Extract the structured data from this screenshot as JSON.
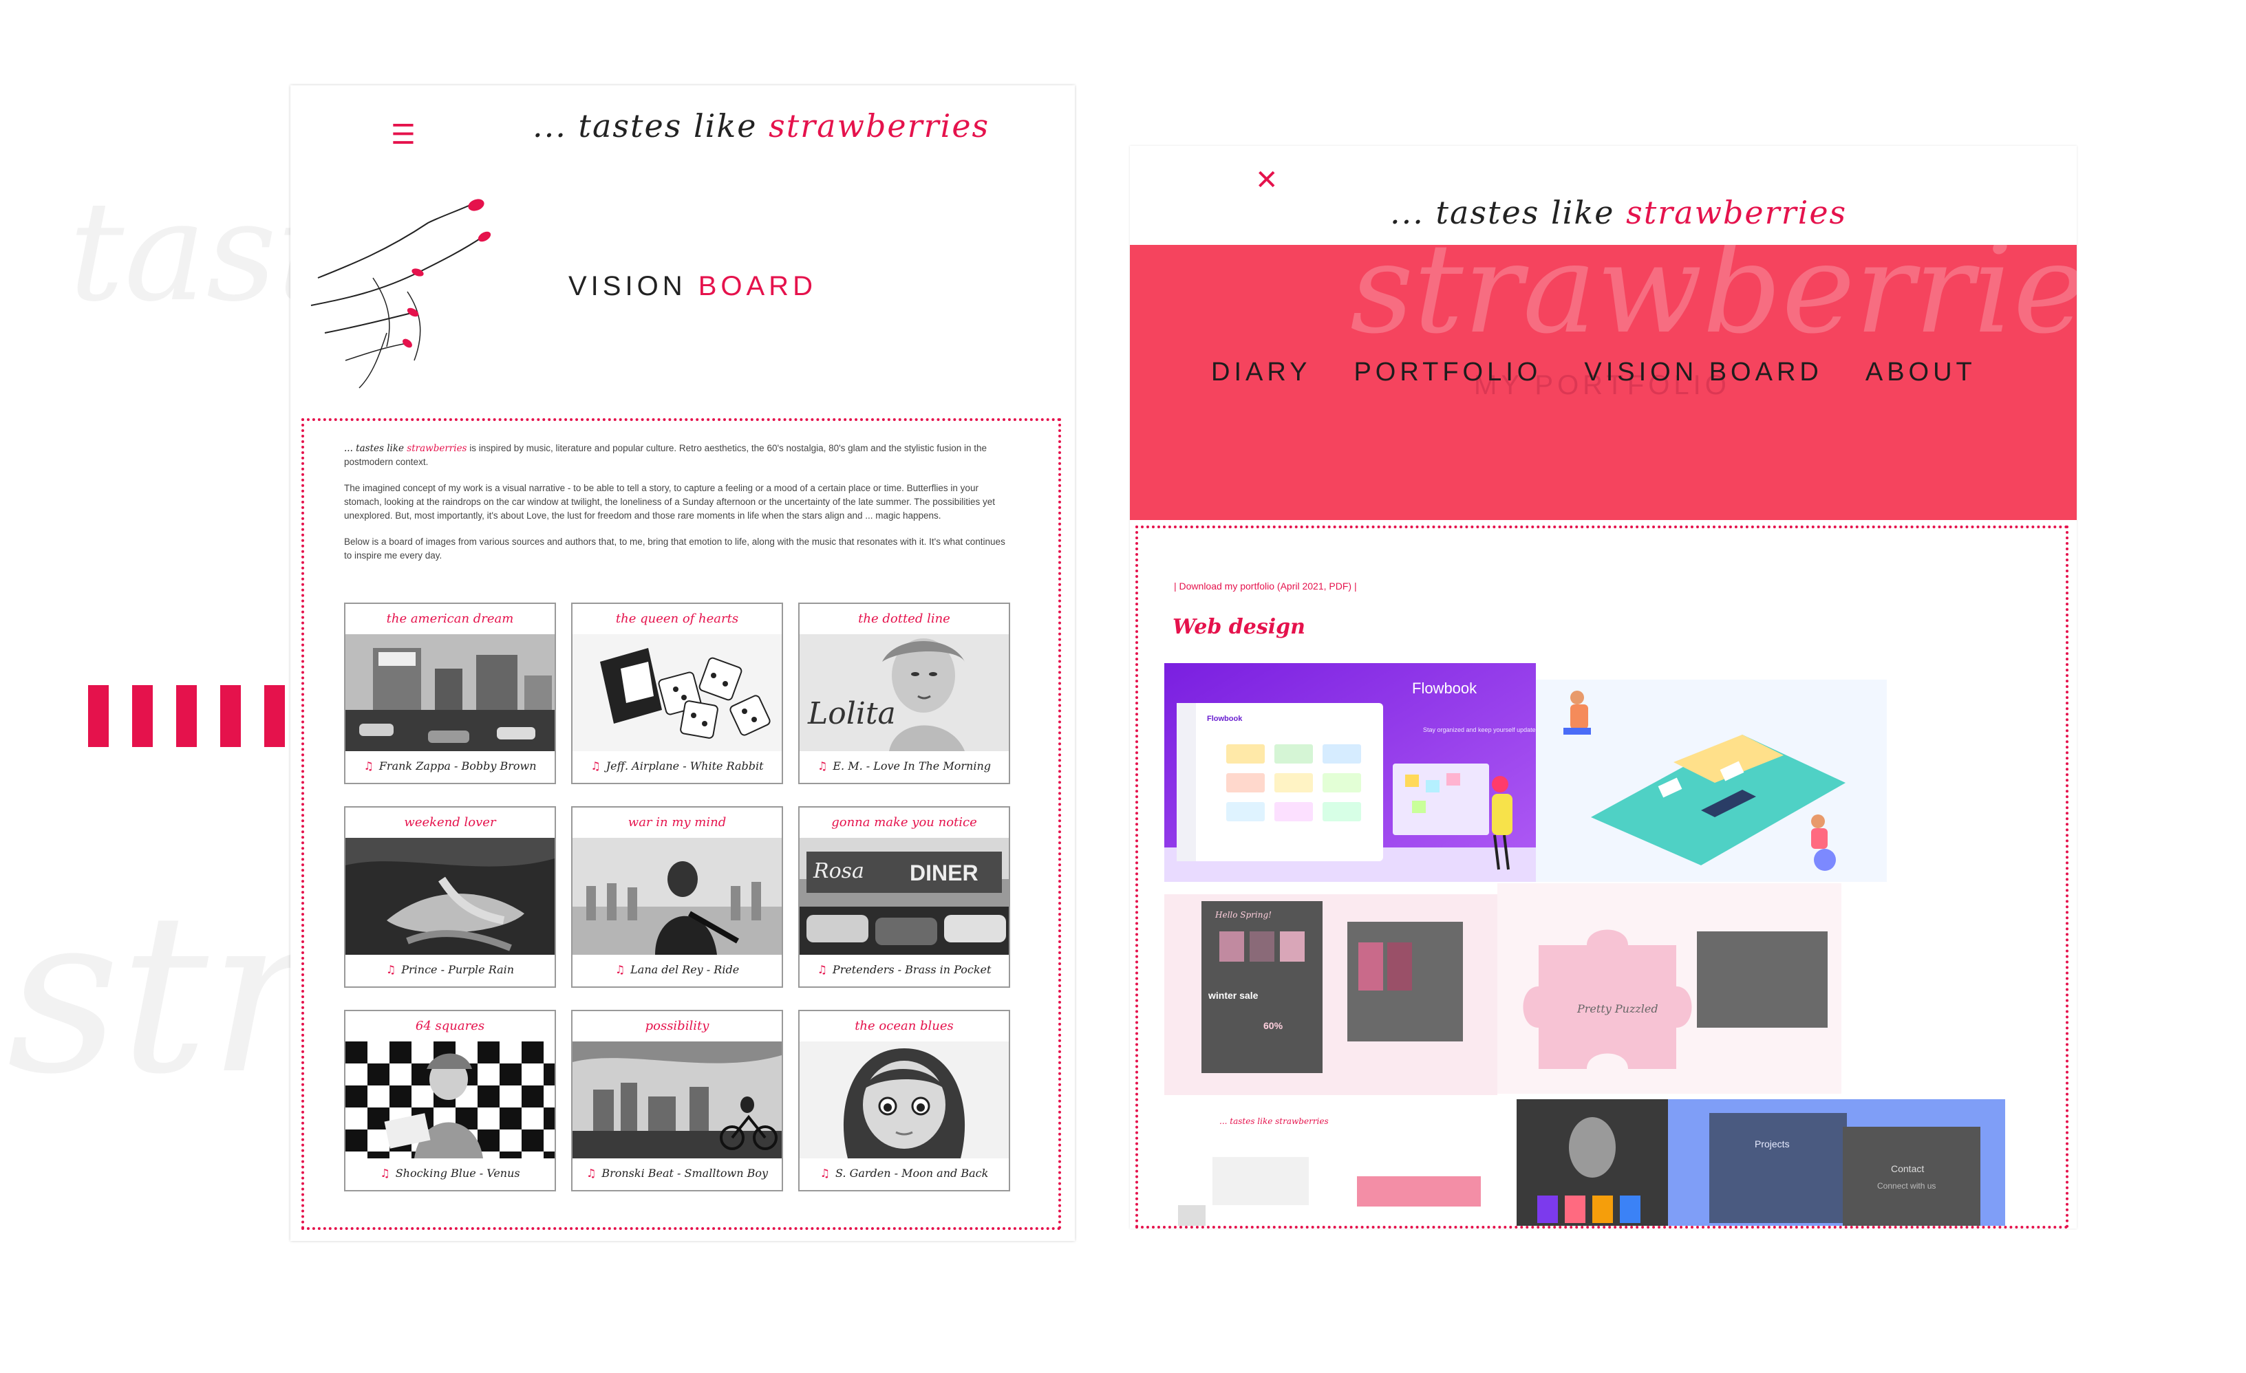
{
  "background": {
    "words": [
      "tastes",
      "str"
    ],
    "accent": "#e5124c"
  },
  "left": {
    "brand": {
      "prefix": "... tastes like ",
      "accent": "strawberries"
    },
    "menu_icon": "hamburger-icon",
    "title": {
      "first": "VISION ",
      "second": "BOARD"
    },
    "intro": {
      "lead_prefix": "... tastes like ",
      "lead_accent": "strawberries",
      "lead_rest": " is inspired by music, literature and popular culture. Retro aesthetics, the 60's nostalgia, 80's glam and the stylistic fusion in the postmodern context.",
      "p2": "The imagined concept of my work is a visual narrative - to be able to tell a story, to capture a feeling or a mood of a certain place or time. Butterflies in your stomach, looking at the raindrops on the car window at twilight, the loneliness of a Sunday afternoon or the uncertainty of the late summer. The possibilities yet unexplored. But, most importantly, it's about Love, the lust for freedom and those rare moments in life when the stars align and ... magic happens.",
      "p3": "Below is a board of images from various sources and authors that, to me, bring that emotion to life, along with the music that resonates with it. It's what continues to inspire me every day."
    },
    "cards": [
      {
        "title": "the american dream",
        "song": "Frank Zappa - Bobby Brown"
      },
      {
        "title": "the queen of hearts",
        "song": "Jeff. Airplane - White Rabbit"
      },
      {
        "title": "the dotted line",
        "song": "E. M. - Love In The Morning",
        "image_text": "Lolita"
      },
      {
        "title": "weekend lover",
        "song": "Prince - Purple Rain"
      },
      {
        "title": "war in my mind",
        "song": "Lana del Rey - Ride"
      },
      {
        "title": "gonna make you notice",
        "song": "Pretenders - Brass in Pocket",
        "image_text": "DINER"
      },
      {
        "title": "64 squares",
        "song": "Shocking Blue - Venus"
      },
      {
        "title": "possibility",
        "song": "Bronski Beat - Smalltown Boy"
      },
      {
        "title": "the ocean blues",
        "song": "S. Garden - Moon and Back"
      }
    ]
  },
  "right": {
    "close_icon": "close-icon",
    "brand": {
      "prefix": "... tastes like ",
      "accent": "strawberries"
    },
    "nav_bg": "#f5445e",
    "ghost_word": "strawberries",
    "ghost_sub": "MY PORTFOLIO",
    "nav": [
      "DIARY",
      "PORTFOLIO",
      "VISION BOARD",
      "ABOUT"
    ],
    "download": "| Download my portfolio (April 2021, PDF) |",
    "section_title": "Web design",
    "thumbs": {
      "flowbook_title": "Flowbook",
      "flowbook_tagline": "Stay organized and keep yourself updated.",
      "pretty_puzzled": "Pretty Puzzled",
      "hello_spring": "Hello Spring!",
      "winter_sale": "winter sale",
      "percent": "60%",
      "projects": "Projects",
      "contact": "Contact",
      "connect": "Connect with us"
    }
  }
}
